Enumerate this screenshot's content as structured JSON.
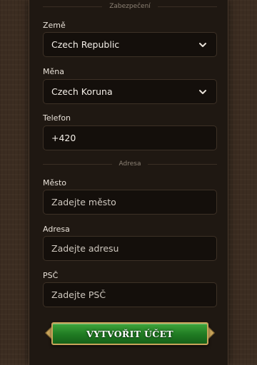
{
  "sections": {
    "security": "Zabezpečení",
    "address": "Adresa"
  },
  "fields": {
    "country": {
      "label": "Země",
      "value": "Czech Republic"
    },
    "currency": {
      "label": "Měna",
      "value": "Czech Koruna"
    },
    "phone": {
      "label": "Telefon",
      "value": "+420"
    },
    "city": {
      "label": "Město",
      "placeholder": "Zadejte město"
    },
    "address": {
      "label": "Adresa",
      "placeholder": "Zadejte adresu"
    },
    "zip": {
      "label": "PSČ",
      "placeholder": "Zadejte PSČ"
    }
  },
  "submit": {
    "label": "VYTVOŘIT ÚČET"
  },
  "colors": {
    "panel": "#1f1812",
    "field_bg": "#140f0b",
    "button": "#1f7a22",
    "button_border": "#c9a45a"
  }
}
